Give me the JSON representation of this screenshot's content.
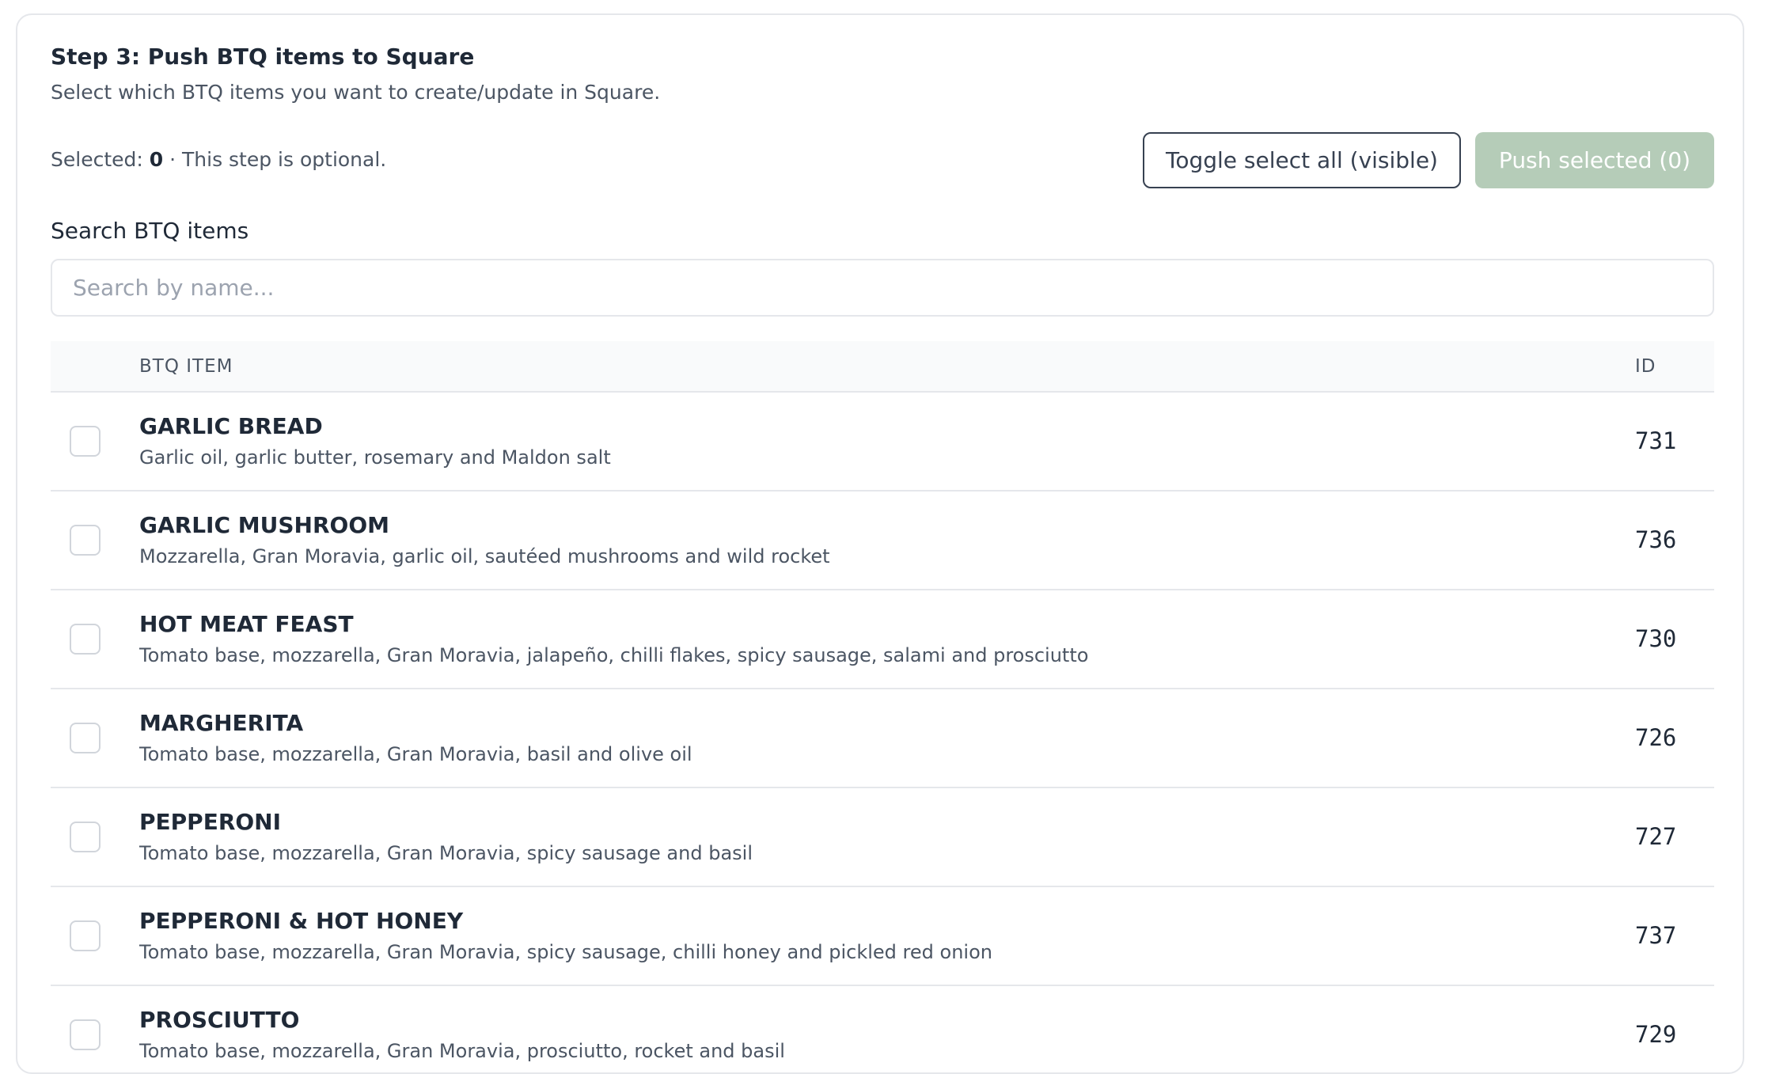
{
  "header": {
    "title": "Step 3: Push BTQ items to Square",
    "subtitle": "Select which BTQ items you want to create/update in Square.",
    "selected_label": "Selected:",
    "selected_count": "0",
    "optional_note": "· This step is optional."
  },
  "actions": {
    "toggle_label": "Toggle select all (visible)",
    "push_label": "Push selected (0)"
  },
  "search": {
    "label": "Search BTQ items",
    "placeholder": "Search by name...",
    "value": ""
  },
  "table": {
    "columns": {
      "item": "BTQ ITEM",
      "id": "ID"
    },
    "rows": [
      {
        "name": "GARLIC BREAD",
        "desc": "Garlic oil, garlic butter, rosemary and Maldon salt",
        "id": "731",
        "checked": false
      },
      {
        "name": "GARLIC MUSHROOM",
        "desc": "Mozzarella, Gran Moravia, garlic oil, sautéed mushrooms and wild rocket",
        "id": "736",
        "checked": false
      },
      {
        "name": "HOT MEAT FEAST",
        "desc": "Tomato base, mozzarella, Gran Moravia, jalapeño, chilli flakes, spicy sausage, salami and prosciutto",
        "id": "730",
        "checked": false
      },
      {
        "name": "MARGHERITA",
        "desc": "Tomato base, mozzarella, Gran Moravia, basil and olive oil",
        "id": "726",
        "checked": false
      },
      {
        "name": "PEPPERONI",
        "desc": "Tomato base, mozzarella, Gran Moravia, spicy sausage and basil",
        "id": "727",
        "checked": false
      },
      {
        "name": "PEPPERONI & HOT HONEY",
        "desc": "Tomato base, mozzarella, Gran Moravia, spicy sausage, chilli honey and pickled red onion",
        "id": "737",
        "checked": false
      },
      {
        "name": "PROSCIUTTO",
        "desc": "Tomato base, mozzarella, Gran Moravia, prosciutto, rocket and basil",
        "id": "729",
        "checked": false
      }
    ]
  },
  "colors": {
    "push_disabled_bg": "#b5ccb8",
    "border": "#e5e7eb",
    "header_bg": "#f9fafb"
  }
}
